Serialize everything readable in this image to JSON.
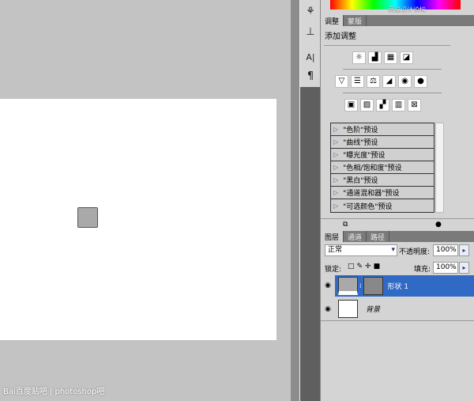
{
  "watermarks": {
    "top": "思缘设计论坛 www.missyuan.com",
    "bottom": "Bai百度贴吧 | photoshop吧"
  },
  "tools": [
    {
      "icon": "three-d-icon",
      "glyph": "⚘"
    },
    {
      "icon": "stamp-icon",
      "glyph": "⊥"
    },
    {
      "icon": "character-icon",
      "glyph": "A|"
    },
    {
      "icon": "paragraph-icon",
      "glyph": "¶"
    }
  ],
  "adjust_panel": {
    "tabs": [
      "调整",
      "蒙版"
    ],
    "title": "添加调整",
    "row1": [
      "☼",
      "▟",
      "▦",
      "◪"
    ],
    "row2": [
      "▽",
      "☰",
      "⚖",
      "◢",
      "◉",
      "●"
    ],
    "row3": [
      "▣",
      "▨",
      "▞",
      "▥",
      "⊠"
    ],
    "presets": [
      "\"色阶\"预设",
      "\"曲线\"预设",
      "\"曝光度\"预设",
      "\"色相/饱和度\"预设",
      "\"黑白\"预设",
      "\"通道混和器\"预设",
      "\"可选颜色\"预设"
    ]
  },
  "layers_panel": {
    "tabs": [
      "图层",
      "通道",
      "路径"
    ],
    "blend_mode": "正常",
    "opacity_label": "不透明度:",
    "opacity": "100%",
    "lock_label": "锁定:",
    "fill_label": "填充:",
    "fill": "100%",
    "layers": [
      {
        "name": "形状 1",
        "selected": true
      },
      {
        "name": "背景",
        "selected": false
      }
    ]
  },
  "colors": {
    "selection": "#316ac5"
  }
}
